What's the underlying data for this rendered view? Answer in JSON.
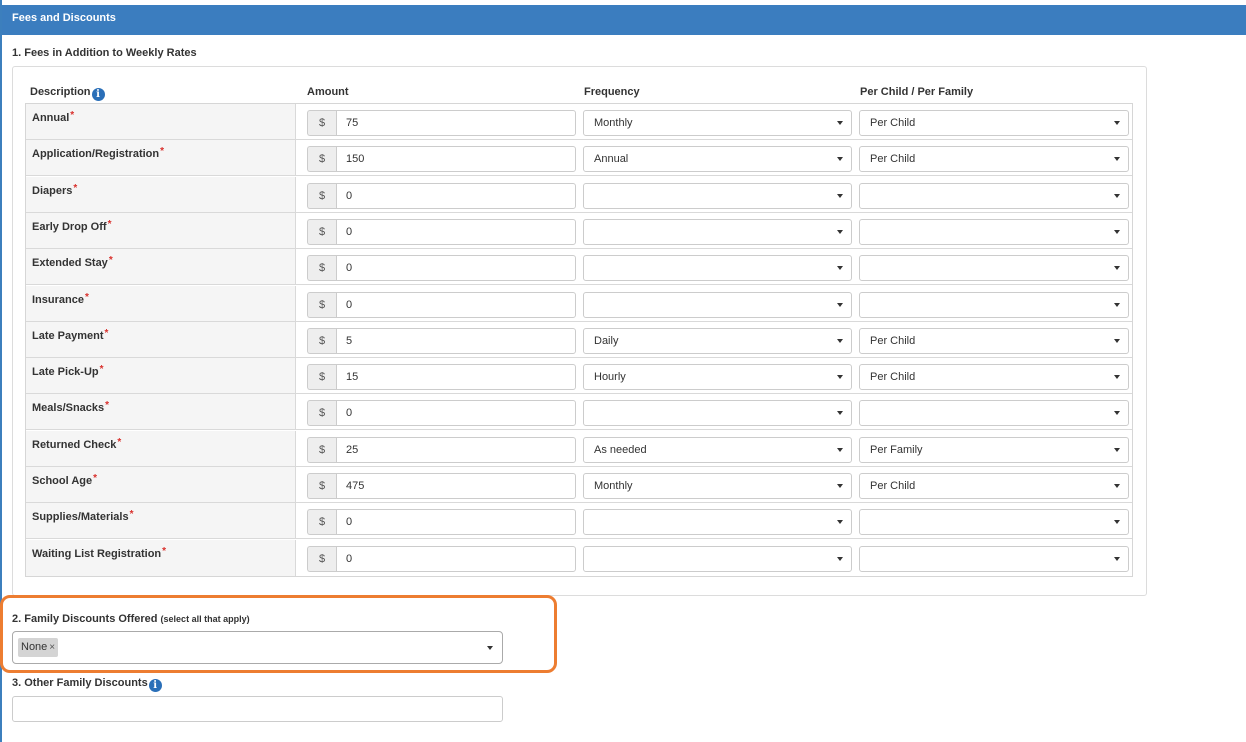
{
  "panel": {
    "title": "Fees and Discounts"
  },
  "section1": {
    "title": "1. Fees in Addition to Weekly Rates"
  },
  "columns": {
    "description": "Description",
    "amount": "Amount",
    "frequency": "Frequency",
    "per": "Per Child / Per Family"
  },
  "currency_symbol": "$",
  "required_marker": "*",
  "rows": [
    {
      "label": "Annual",
      "amount": "75",
      "frequency": "Monthly",
      "per": "Per Child"
    },
    {
      "label": "Application/Registration",
      "amount": "150",
      "frequency": "Annual",
      "per": "Per Child"
    },
    {
      "label": "Diapers",
      "amount": "0",
      "frequency": "",
      "per": ""
    },
    {
      "label": "Early Drop Off",
      "amount": "0",
      "frequency": "",
      "per": ""
    },
    {
      "label": "Extended Stay",
      "amount": "0",
      "frequency": "",
      "per": ""
    },
    {
      "label": "Insurance",
      "amount": "0",
      "frequency": "",
      "per": ""
    },
    {
      "label": "Late Payment",
      "amount": "5",
      "frequency": "Daily",
      "per": "Per Child"
    },
    {
      "label": "Late Pick-Up",
      "amount": "15",
      "frequency": "Hourly",
      "per": "Per Child"
    },
    {
      "label": "Meals/Snacks",
      "amount": "0",
      "frequency": "",
      "per": ""
    },
    {
      "label": "Returned Check",
      "amount": "25",
      "frequency": "As needed",
      "per": "Per Family"
    },
    {
      "label": "School Age",
      "amount": "475",
      "frequency": "Monthly",
      "per": "Per Child"
    },
    {
      "label": "Supplies/Materials",
      "amount": "0",
      "frequency": "",
      "per": ""
    },
    {
      "label": "Waiting List Registration",
      "amount": "0",
      "frequency": "",
      "per": ""
    }
  ],
  "section2": {
    "title": "2. Family Discounts Offered",
    "hint": "(select all that apply)",
    "selected_tag": "None",
    "tag_remove": "×"
  },
  "section3": {
    "title": "3. Other Family Discounts",
    "value": ""
  },
  "icons": {
    "info": "info-icon",
    "dropdown": "chevron-down-icon"
  },
  "colors": {
    "header_bg": "#3b7dbf",
    "required": "#d9302c",
    "highlight": "#ed7d31",
    "info_icon": "#2a6fb8"
  }
}
